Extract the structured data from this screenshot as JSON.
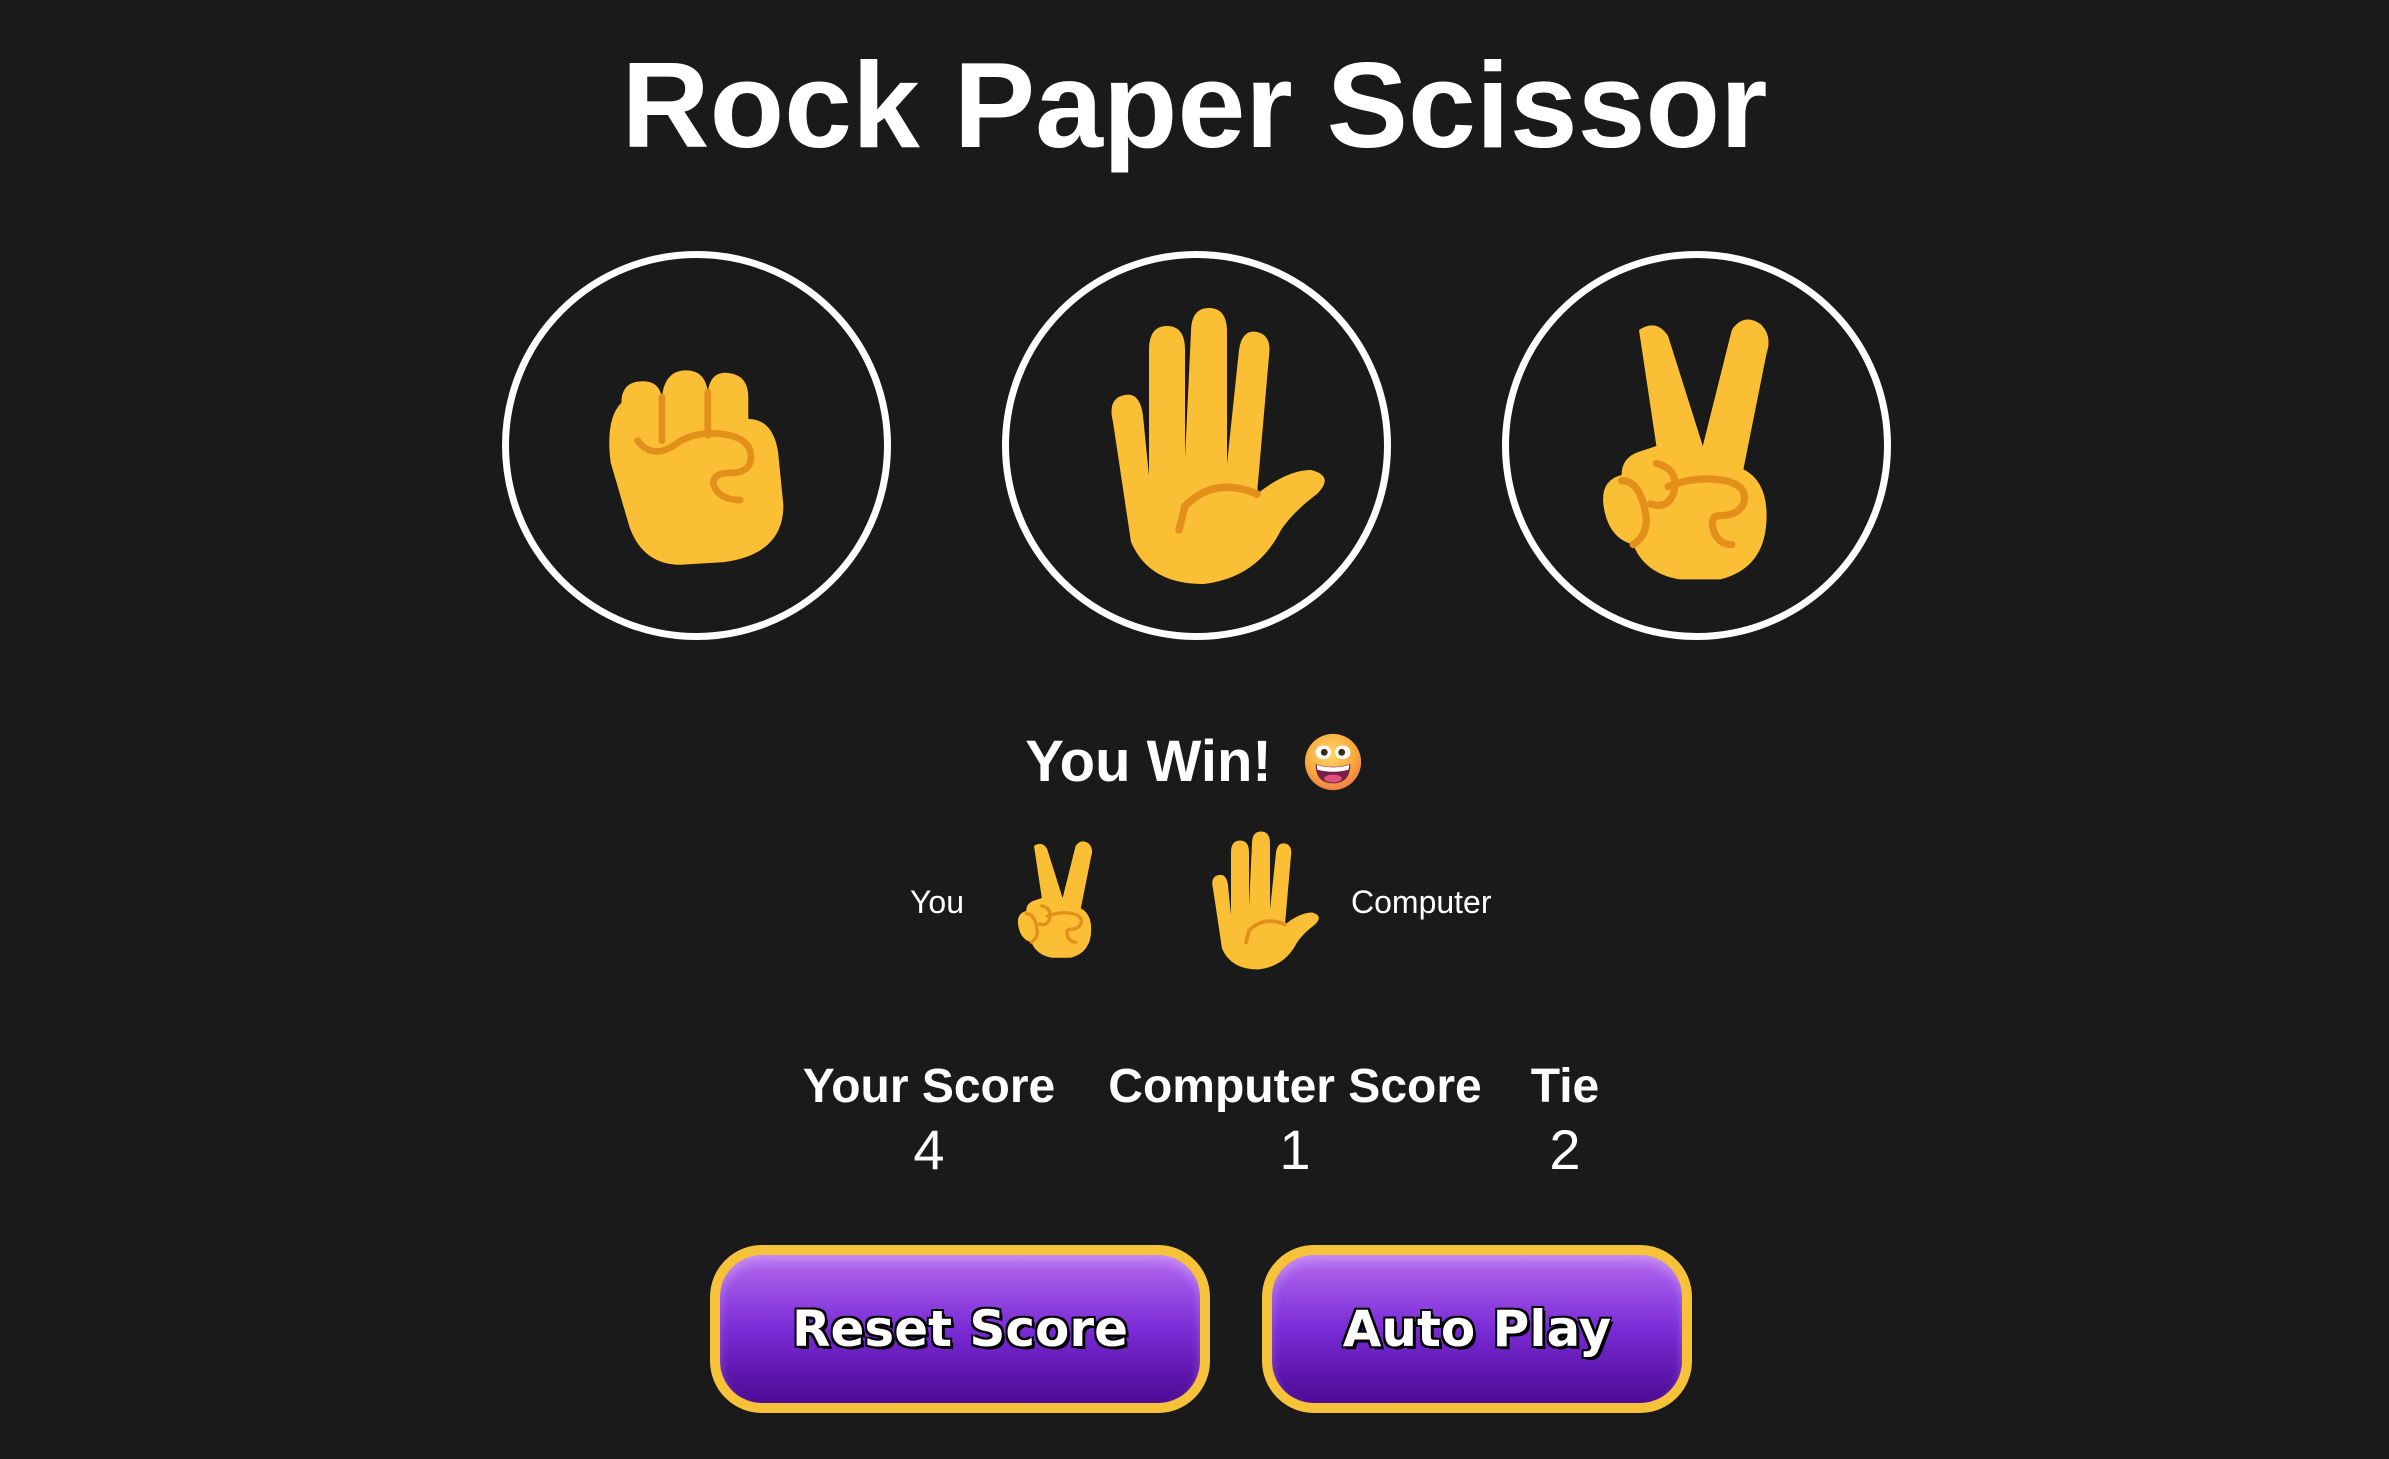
{
  "title": "Rock Paper Scissor",
  "moves": [
    {
      "name": "rock",
      "icon": "raised-fist"
    },
    {
      "name": "paper",
      "icon": "raised-hand"
    },
    {
      "name": "scissors",
      "icon": "victory-hand"
    }
  ],
  "result": {
    "text": "You Win!",
    "icon": "grinning-face"
  },
  "last_round": {
    "you_label": "You",
    "computer_label": "Computer",
    "player_move_icon": "victory-hand",
    "computer_move_icon": "raised-hand"
  },
  "scores": {
    "your_score_label": "Your Score",
    "your_score": "4",
    "computer_score_label": "Computer Score",
    "computer_score": "1",
    "tie_label": "Tie",
    "tie": "2"
  },
  "buttons": {
    "reset_label": "Reset Score",
    "autoplay_label": "Auto Play"
  },
  "colors": {
    "background": "#1a1a1a",
    "hand_skin": "#fbbf36",
    "hand_line": "#e3901a",
    "button_border": "#f5c23a",
    "button_purple_top": "#b66cf0",
    "button_purple_bottom": "#4c0a94"
  }
}
